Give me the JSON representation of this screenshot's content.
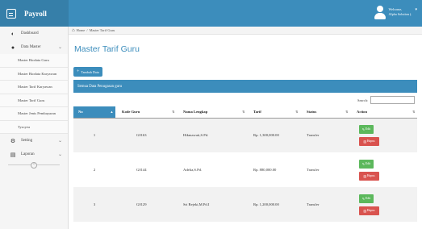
{
  "header": {
    "app_title": "Payroll",
    "user_line1": "Welcome,",
    "user_line2": "Alpha Solution (."
  },
  "sidebar": {
    "items": [
      {
        "label": "Dashboard",
        "icon": "dashboard-icon"
      },
      {
        "label": "Data Master",
        "icon": "user-icon"
      }
    ],
    "sub_items": [
      "Master Biodata Guru",
      "Master Biodata Karyawan",
      "Master Tarif Karyawan",
      "Master Tarif Guru",
      "Master Jenis Pembayaran",
      "Tyroyea"
    ],
    "setting_label": "Setting",
    "laporan_label": "Laporan",
    "separator_icon": "<"
  },
  "breadcrumb": {
    "home": "Home",
    "separator": "/",
    "current": "Master Tarif Guru"
  },
  "page": {
    "title": "Master Tarif Guru",
    "add_button": "Tambah Data",
    "panel_title": "Semua Data Penugasan guru",
    "search_label": "Search:",
    "search_value": ""
  },
  "table": {
    "columns": [
      "No",
      "Kode Guru",
      "Nama Lengkap",
      "Tarif",
      "Status",
      "Action"
    ],
    "rows": [
      {
        "no": "1",
        "kode": "G0163",
        "nama": "Hikmawati,S.Pd.",
        "tarif": "Rp. 1,300,000.00",
        "status": "Transfer"
      },
      {
        "no": "2",
        "kode": "G0144",
        "nama": "Adelia,S.Pd.",
        "tarif": "Rp. 880,000.00",
        "status": "Transfer"
      },
      {
        "no": "3",
        "kode": "G0129",
        "nama": "Sri Rejeki,M.Pd.I",
        "tarif": "Rp. 1,200,000.00",
        "status": "Transfer"
      }
    ],
    "edit_label": "Edit",
    "delete_label": "Hapus"
  },
  "colors": {
    "primary": "#3c8dbc",
    "edit": "#5cb85c",
    "delete": "#d9534f"
  }
}
